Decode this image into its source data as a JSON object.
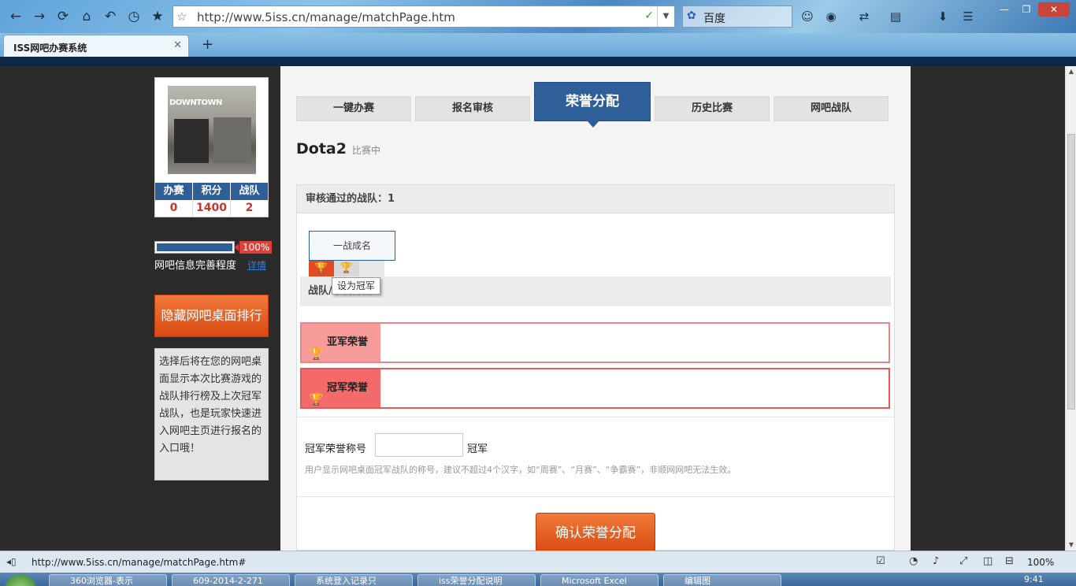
{
  "browser": {
    "url": "http://www.5iss.cn/manage/matchPage.htm",
    "search_engine": "百度",
    "tab_title": "ISS网吧办赛系统",
    "new_tab": "+",
    "status_url": "http://www.5iss.cn/manage/matchPage.htm#",
    "zoom": "100%",
    "clock": "9:41"
  },
  "icons": {
    "back": "←",
    "forward": "→",
    "reload": "⟳",
    "home": "⌂",
    "undo": "↶",
    "history": "◷",
    "favorite": "★",
    "url_star": "☆",
    "leaf": "✓",
    "dropdown": "▼",
    "paw": "✿",
    "minimize": "—",
    "restore": "❐",
    "close": "✕",
    "tab_close": "✕",
    "trophy_gold": "🏆",
    "trophy_silver": "🏆"
  },
  "sidebar": {
    "photo_sign": "DOWNTOWN",
    "stats": [
      {
        "label": "办赛",
        "value": "0"
      },
      {
        "label": "积分",
        "value": "1400"
      },
      {
        "label": "战队",
        "value": "2"
      }
    ],
    "progress": 1.0,
    "progress_label": "100%",
    "info_label": "网吧信息完善程度",
    "info_link": "详情",
    "hide_button": "隐藏网吧桌面排行",
    "description": "选择后将在您的网吧桌面显示本次比赛游戏的战队排行榜及上次冠军战队，也是玩家快速进入网吧主页进行报名的入口哦！"
  },
  "tabs": [
    {
      "label": "一键办赛"
    },
    {
      "label": "报名审核"
    },
    {
      "label": "荣誉分配"
    },
    {
      "label": "历史比赛"
    },
    {
      "label": "网吧战队"
    }
  ],
  "game": {
    "title": "Dota2",
    "status": "比赛中"
  },
  "teams": {
    "header": "审核通过的战队：1",
    "team_name": "一战成名",
    "section_label": "战队/荣誉分配",
    "tooltip": "设为冠军"
  },
  "honors": {
    "silver_label": "亚军荣誉",
    "gold_label": "冠军荣誉"
  },
  "title_form": {
    "label": "冠军荣誉称号",
    "value": "",
    "suffix": "冠军",
    "hint": "用户显示网吧桌面冠军战队的称号，建议不超过4个汉字，如“周赛”、“月赛”、“争霸赛”，非顺网网吧无法生效。"
  },
  "confirm_button": "确认荣誉分配",
  "taskbar_items": [
    "360浏览器-表示",
    "609-2014-2-271",
    "系统登入记录只",
    "iss荣誉分配说明",
    "Microsoft Excel",
    "编辑图"
  ]
}
